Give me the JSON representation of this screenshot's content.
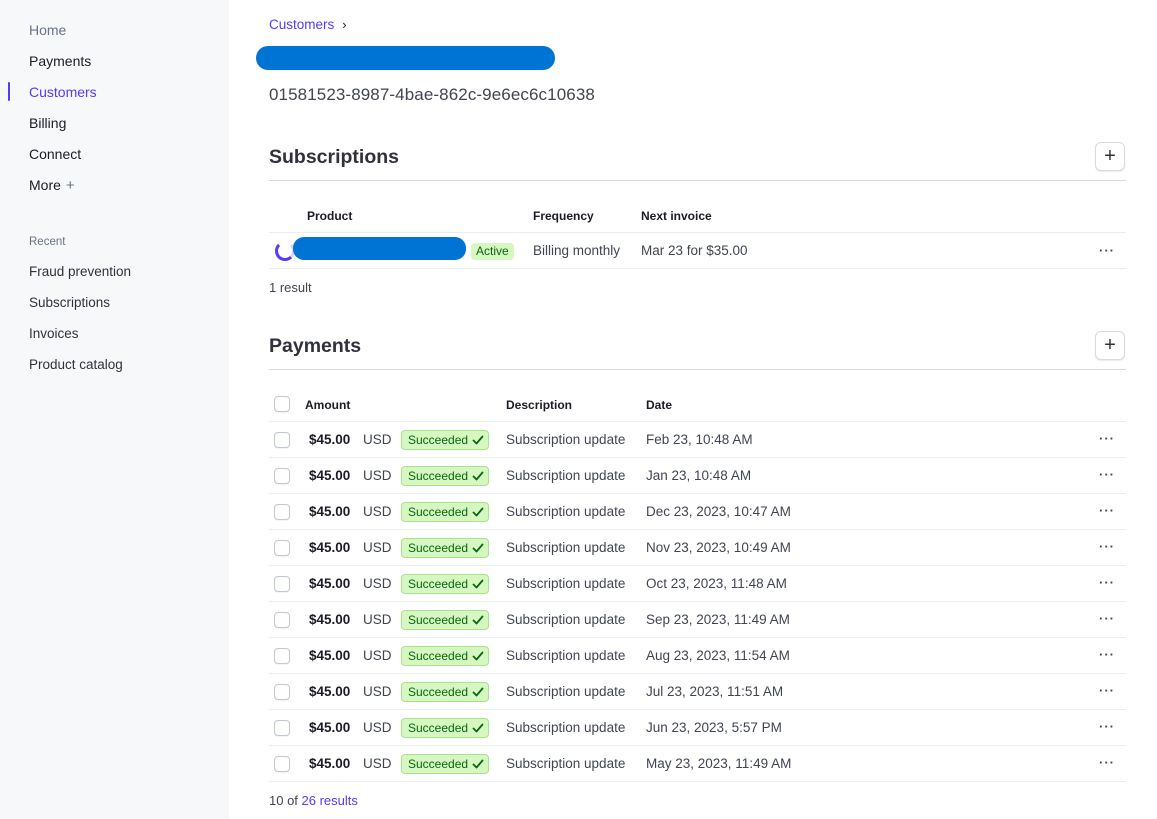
{
  "sidebar": {
    "nav": [
      {
        "label": "Home",
        "key": "home"
      },
      {
        "label": "Payments",
        "key": "payments"
      },
      {
        "label": "Customers",
        "key": "customers"
      },
      {
        "label": "Billing",
        "key": "billing"
      },
      {
        "label": "Connect",
        "key": "connect"
      },
      {
        "label": "More",
        "key": "more"
      }
    ],
    "more_icon": "+",
    "recent_label": "Recent",
    "recent": [
      "Fraud prevention",
      "Subscriptions",
      "Invoices",
      "Product catalog"
    ]
  },
  "breadcrumb": {
    "label": "Customers",
    "chevron": "›"
  },
  "customer": {
    "id": "01581523-8987-4bae-862c-9e6ec6c10638"
  },
  "subscriptions": {
    "title": "Subscriptions",
    "add_icon": "+",
    "headers": {
      "product": "Product",
      "frequency": "Frequency",
      "next_invoice": "Next invoice"
    },
    "rows": [
      {
        "status": "Active",
        "frequency": "Billing monthly",
        "next_invoice": "Mar 23 for $35.00"
      }
    ],
    "result_count": "1 result"
  },
  "payments": {
    "title": "Payments",
    "add_icon": "+",
    "headers": {
      "amount": "Amount",
      "description": "Description",
      "date": "Date"
    },
    "rows": [
      {
        "amount": "$45.00",
        "currency": "USD",
        "status": "Succeeded",
        "description": "Subscription update",
        "date": "Feb 23, 10:48 AM"
      },
      {
        "amount": "$45.00",
        "currency": "USD",
        "status": "Succeeded",
        "description": "Subscription update",
        "date": "Jan 23, 10:48 AM"
      },
      {
        "amount": "$45.00",
        "currency": "USD",
        "status": "Succeeded",
        "description": "Subscription update",
        "date": "Dec 23, 2023, 10:47 AM"
      },
      {
        "amount": "$45.00",
        "currency": "USD",
        "status": "Succeeded",
        "description": "Subscription update",
        "date": "Nov 23, 2023, 10:49 AM"
      },
      {
        "amount": "$45.00",
        "currency": "USD",
        "status": "Succeeded",
        "description": "Subscription update",
        "date": "Oct 23, 2023, 11:48 AM"
      },
      {
        "amount": "$45.00",
        "currency": "USD",
        "status": "Succeeded",
        "description": "Subscription update",
        "date": "Sep 23, 2023, 11:49 AM"
      },
      {
        "amount": "$45.00",
        "currency": "USD",
        "status": "Succeeded",
        "description": "Subscription update",
        "date": "Aug 23, 2023, 11:54 AM"
      },
      {
        "amount": "$45.00",
        "currency": "USD",
        "status": "Succeeded",
        "description": "Subscription update",
        "date": "Jul 23, 2023, 11:51 AM"
      },
      {
        "amount": "$45.00",
        "currency": "USD",
        "status": "Succeeded",
        "description": "Subscription update",
        "date": "Jun 23, 2023, 5:57 PM"
      },
      {
        "amount": "$45.00",
        "currency": "USD",
        "status": "Succeeded",
        "description": "Subscription update",
        "date": "May 23, 2023, 11:49 AM"
      }
    ],
    "result_prefix": "10 of ",
    "result_link": "26 results"
  },
  "row_menu_icon": "···",
  "colors": {
    "accent": "#533afd",
    "success_bg": "#d7f7c2",
    "success_text": "#05690d",
    "redaction": "#0074d4"
  }
}
